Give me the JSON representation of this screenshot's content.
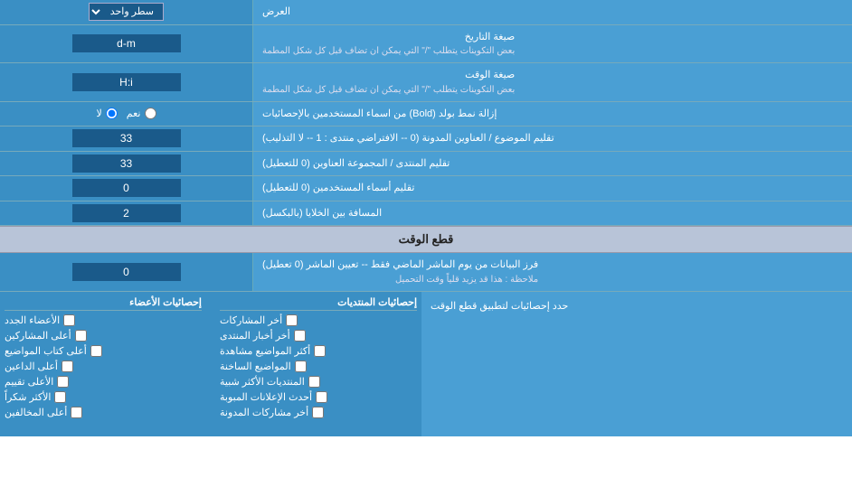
{
  "page": {
    "title": "العرض"
  },
  "rows": {
    "display_mode": {
      "label": "العرض",
      "select_options": [
        "سطر واحد"
      ],
      "selected": "سطر واحد"
    },
    "date_format": {
      "label": "صيغة التاريخ",
      "sublabel": "بعض التكوينات يتطلب \"/\" التي يمكن ان تضاف قبل كل شكل المطمة",
      "value": "d-m"
    },
    "time_format": {
      "label": "صيغة الوقت",
      "sublabel": "بعض التكوينات يتطلب \"/\" التي يمكن ان تضاف قبل كل شكل المطمة",
      "value": "H:i"
    },
    "bold_remove": {
      "label": "إزالة نمط بولد (Bold) من اسماء المستخدمين بالإحصائيات",
      "radio_yes": "نعم",
      "radio_no": "لا",
      "selected": "no"
    },
    "topic_titles": {
      "label": "تقليم الموضوع / العناوين المدونة (0 -- الافتراضي منتدى : 1 -- لا التذليب)",
      "value": "33"
    },
    "forum_titles": {
      "label": "تقليم المنتدى / المجموعة العناوين (0 للتعطيل)",
      "value": "33"
    },
    "usernames": {
      "label": "تقليم أسماء المستخدمين (0 للتعطيل)",
      "value": "0"
    },
    "cell_spacing": {
      "label": "المسافة بين الخلايا (بالبكسل)",
      "value": "2"
    },
    "cutoff_section": {
      "title": "قطع الوقت"
    },
    "cutoff_days": {
      "label": "فرز البيانات من يوم الماشر الماضي فقط -- تعيين الماشر (0 تعطيل)",
      "sublabel": "ملاحظة : هذا قد يزيد قلياً وقت التحميل",
      "value": "0"
    },
    "cutoff_stats": {
      "label": "حدد إحصائيات لتطبيق قطع الوقت"
    }
  },
  "checkboxes": {
    "col1_header": "إحصائيات المنتديات",
    "col1_items": [
      "أخر المشاركات",
      "أخر أخبار المنتدى",
      "أكثر المواضيع مشاهدة",
      "المواضيع الساخنة",
      "المنتديات الأكثر شبية",
      "أحدث الإعلانات المبوبة",
      "أخر مشاركات المدونة"
    ],
    "col2_header": "إحصائيات الأعضاء",
    "col2_items": [
      "الأعضاء الجدد",
      "أعلى المشاركين",
      "أعلى كتاب المواضيع",
      "أعلى الداعين",
      "الأعلى تقييم",
      "الأكثر شكراً",
      "أعلى المخالفين"
    ]
  }
}
